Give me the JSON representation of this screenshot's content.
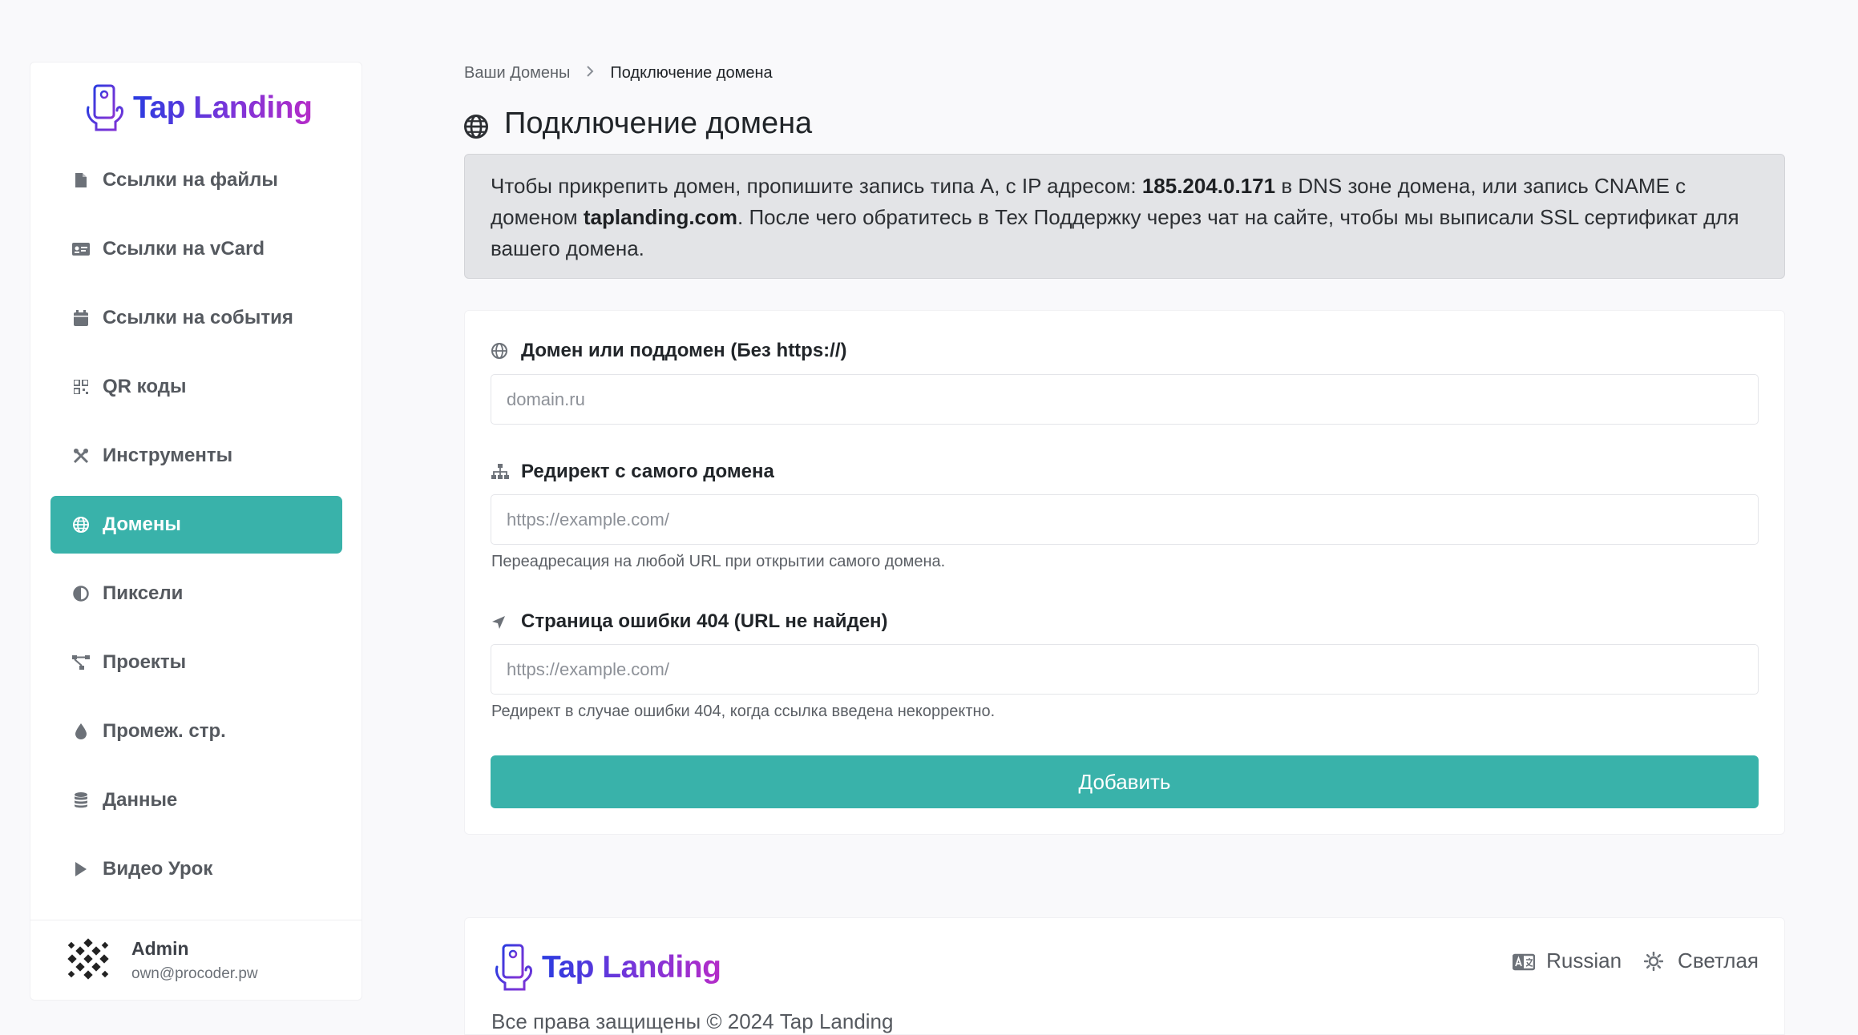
{
  "brand": {
    "name": "Tap Landing"
  },
  "sidebar": {
    "items": [
      {
        "label": "Ссылки на файлы",
        "icon": "file-icon"
      },
      {
        "label": "Ссылки на vCard",
        "icon": "id-card-icon"
      },
      {
        "label": "Ссылки на события",
        "icon": "calendar-icon"
      },
      {
        "label": "QR коды",
        "icon": "qrcode-icon"
      },
      {
        "label": "Инструменты",
        "icon": "tools-icon"
      },
      {
        "label": "Домены",
        "icon": "globe-icon",
        "active": true
      },
      {
        "label": "Пиксели",
        "icon": "adjust-icon"
      },
      {
        "label": "Проекты",
        "icon": "project-diagram-icon"
      },
      {
        "label": "Промеж. стр.",
        "icon": "droplet-icon"
      },
      {
        "label": "Данные",
        "icon": "database-icon"
      },
      {
        "label": "Видео Урок",
        "icon": "play-icon"
      }
    ],
    "user": {
      "name": "Admin",
      "email": "own@procoder.pw"
    }
  },
  "breadcrumb": {
    "parent": "Ваши Домены",
    "current": "Подключение домена"
  },
  "page": {
    "title": "Подключение домена"
  },
  "notice": {
    "part1": "Чтобы прикрепить домен, пропишите запись типа A, с IP адресом: ",
    "ip": "185.204.0.171",
    "part2": " в DNS зоне домена, или запись CNAME с доменом ",
    "domain": "taplanding.com",
    "part3": ". После чего обратитесь в Тех Поддержку через чат на сайте, чтобы мы выписали SSL сертификат для вашего домена."
  },
  "form": {
    "domain": {
      "label": "Домен или поддомен (Без https://)",
      "placeholder": "domain.ru",
      "value": ""
    },
    "redirect": {
      "label": "Редирект с самого домена",
      "placeholder": "https://example.com/",
      "value": "",
      "hint": "Переадресация на любой URL при открытии самого домена."
    },
    "not_found": {
      "label": "Страница ошибки 404 (URL не найден)",
      "placeholder": "https://example.com/",
      "value": "",
      "hint": "Редирект в случае ошибки 404, когда ссылка введена некорректно."
    },
    "submit_label": "Добавить"
  },
  "footer": {
    "copyright": "Все права защищены © 2024 Tap Landing",
    "language": "Russian",
    "theme": "Светлая"
  },
  "colors": {
    "accent": "#39b2aa",
    "notice_bg": "#e3e4e7",
    "page_bg": "#f9f9fb"
  }
}
